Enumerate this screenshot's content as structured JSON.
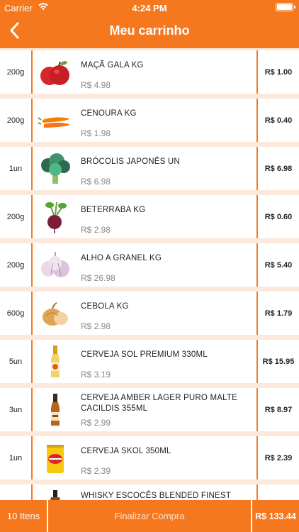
{
  "status_bar": {
    "carrier": "Carrier",
    "time": "4:24 PM"
  },
  "header": {
    "title": "Meu carrinho",
    "back_icon": "chevron-left-icon"
  },
  "colors": {
    "accent": "#f5781f",
    "background": "#fde9dc"
  },
  "items": [
    {
      "qty": "200g",
      "name": "MAÇÃ GALA KG",
      "unit_price": "R$ 4.98",
      "total": "R$ 1.00",
      "icon": "apple"
    },
    {
      "qty": "200g",
      "name": "CENOURA KG",
      "unit_price": "R$ 1.98",
      "total": "R$ 0.40",
      "icon": "carrot"
    },
    {
      "qty": "1un",
      "name": "BRÓCOLIS JAPONÊS UN",
      "unit_price": "R$ 6.98",
      "total": "R$ 6.98",
      "icon": "broccoli"
    },
    {
      "qty": "200g",
      "name": "BETERRABA KG",
      "unit_price": "R$ 2.98",
      "total": "R$ 0.60",
      "icon": "beet"
    },
    {
      "qty": "200g",
      "name": "ALHO A GRANEL KG",
      "unit_price": "R$ 26.98",
      "total": "R$ 5.40",
      "icon": "garlic"
    },
    {
      "qty": "600g",
      "name": "CEBOLA KG",
      "unit_price": "R$ 2.98",
      "total": "R$ 1.79",
      "icon": "onion"
    },
    {
      "qty": "5un",
      "name": "CERVEJA SOL PREMIUM 330ML",
      "unit_price": "R$ 3.19",
      "total": "R$ 15.95",
      "icon": "beer-bottle-light"
    },
    {
      "qty": "3un",
      "name": "CERVEJA AMBER LAGER PURO MALTE CACILDIS 355ML",
      "unit_price": "R$ 2.99",
      "total": "R$ 8.97",
      "icon": "beer-bottle-amber"
    },
    {
      "qty": "1un",
      "name": "CERVEJA SKOL 350ML",
      "unit_price": "R$ 2.39",
      "total": "R$ 2.39",
      "icon": "beer-can"
    },
    {
      "qty": "",
      "name": "WHISKY ESCOCÊS BLENDED FINEST",
      "unit_price": "",
      "total": "",
      "icon": "whisky-bottle"
    }
  ],
  "footer": {
    "count": "10 Itens",
    "checkout": "Finalizar Compra",
    "grand_total": "R$ 133.44"
  }
}
